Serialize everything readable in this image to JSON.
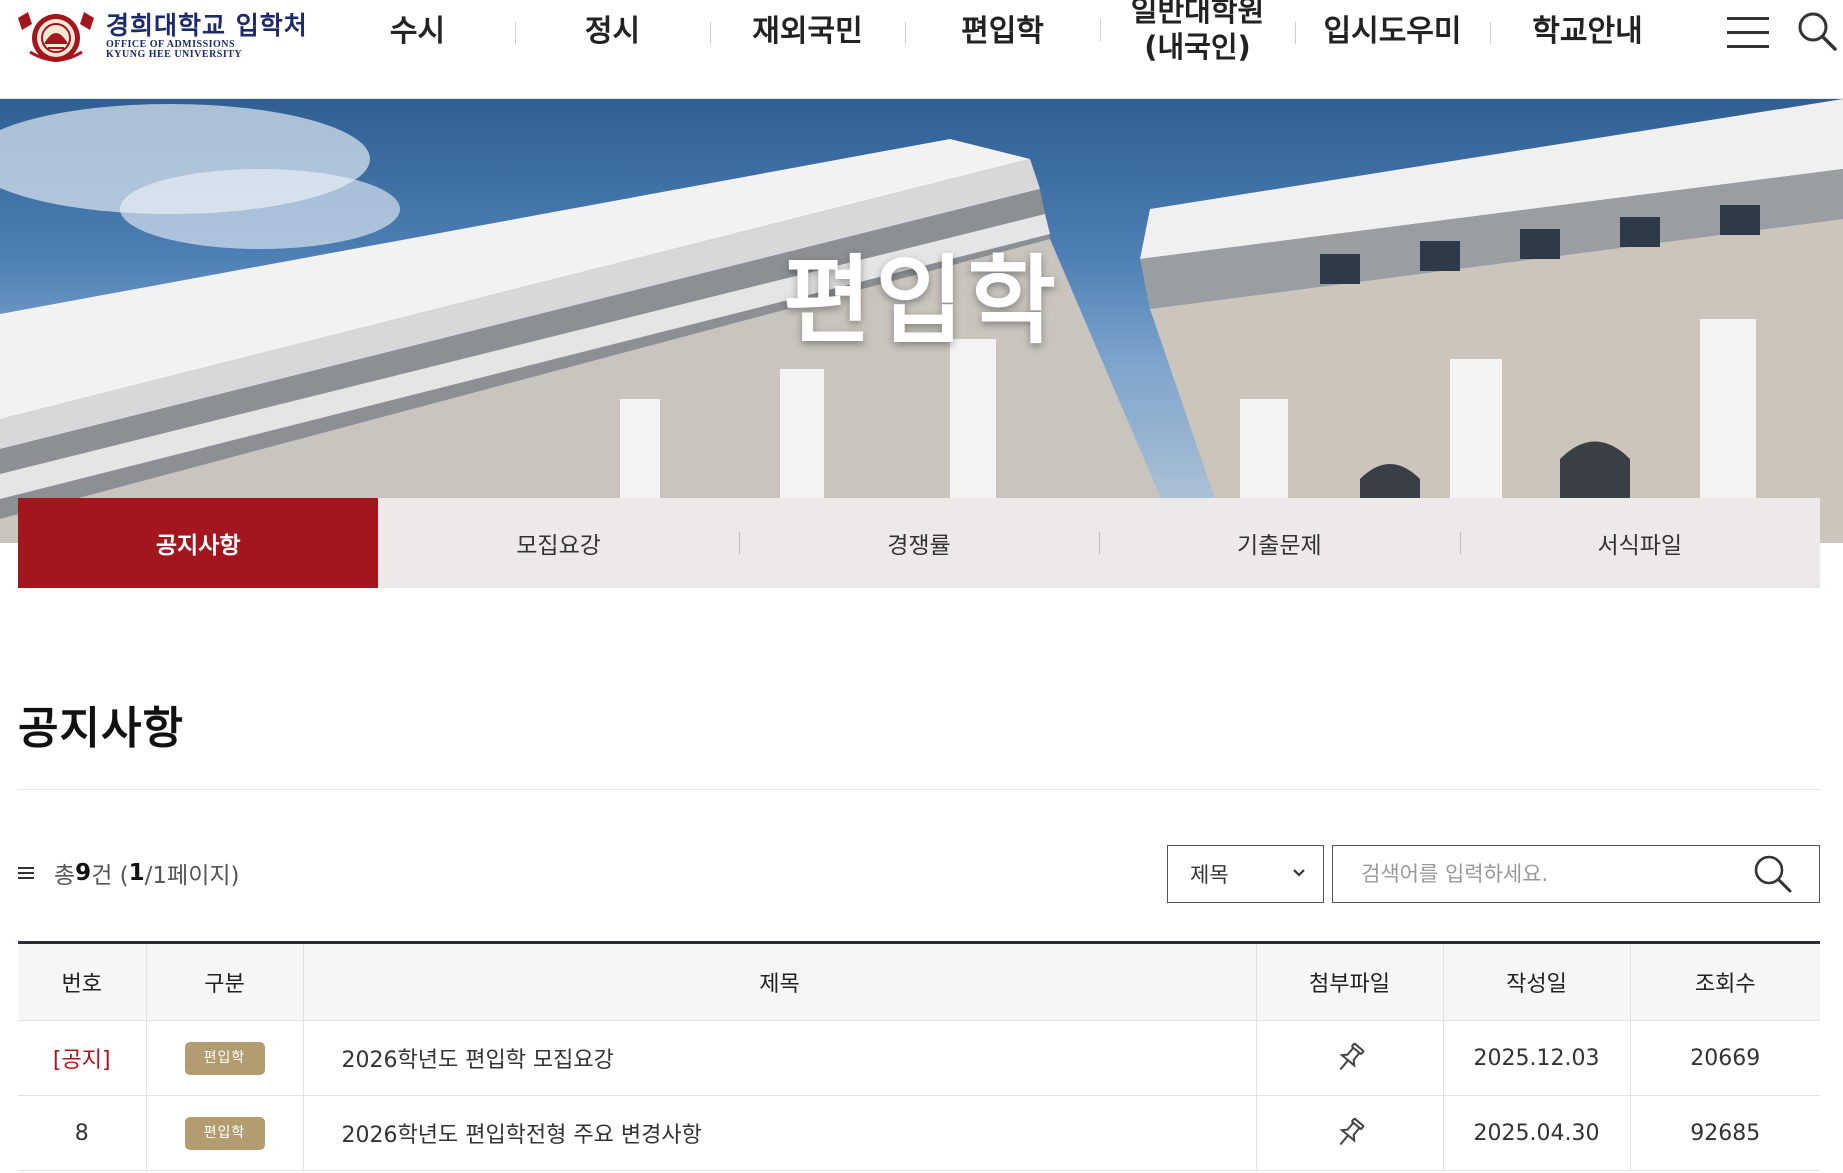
{
  "header": {
    "logo_title": "경희대학교 입학처",
    "logo_sub1": "OFFICE OF ADMISSIONS",
    "logo_sub2": "KYUNG HEE UNIVERSITY",
    "nav": [
      {
        "label": "수시"
      },
      {
        "label": "정시"
      },
      {
        "label": "재외국민"
      },
      {
        "label": "편입학"
      },
      {
        "label_line1": "일반대학원",
        "label_line2": "(내국인)"
      },
      {
        "label": "입시도우미"
      },
      {
        "label": "학교안내"
      }
    ],
    "menu_icon": "hamburger-icon",
    "search_icon": "search-icon"
  },
  "hero": {
    "title": "편입학"
  },
  "subtabs": [
    {
      "label": "공지사항",
      "active": true
    },
    {
      "label": "모집요강",
      "active": false
    },
    {
      "label": "경쟁률",
      "active": false
    },
    {
      "label": "기출문제",
      "active": false
    },
    {
      "label": "서식파일",
      "active": false
    }
  ],
  "board": {
    "title": "공지사항",
    "count_prefix": "총 ",
    "count_total": "9",
    "count_unit": "건 (",
    "count_page": "1",
    "count_suffix": "/1페이지)",
    "search_field": "제목",
    "search_placeholder": "검색어를 입력하세요.",
    "columns": [
      "번호",
      "구분",
      "제목",
      "첨부파일",
      "작성일",
      "조회수"
    ],
    "rows": [
      {
        "no": "[공지]",
        "category": "편입학",
        "subject": "2026학년도 편입학 모집요강",
        "attachment_icon": "pushpin-icon",
        "date": "2025.12.03",
        "views": "20669"
      },
      {
        "no": "8",
        "category": "편입학",
        "subject": "2026학년도 편입학전형 주요 변경사항",
        "attachment_icon": "pushpin-icon",
        "date": "2025.04.30",
        "views": "92685"
      }
    ]
  },
  "colors": {
    "brand_navy": "#1b2a6b",
    "accent_red": "#a3161d",
    "badge_gold": "#b39c70",
    "tab_bg": "#ece9e8"
  }
}
